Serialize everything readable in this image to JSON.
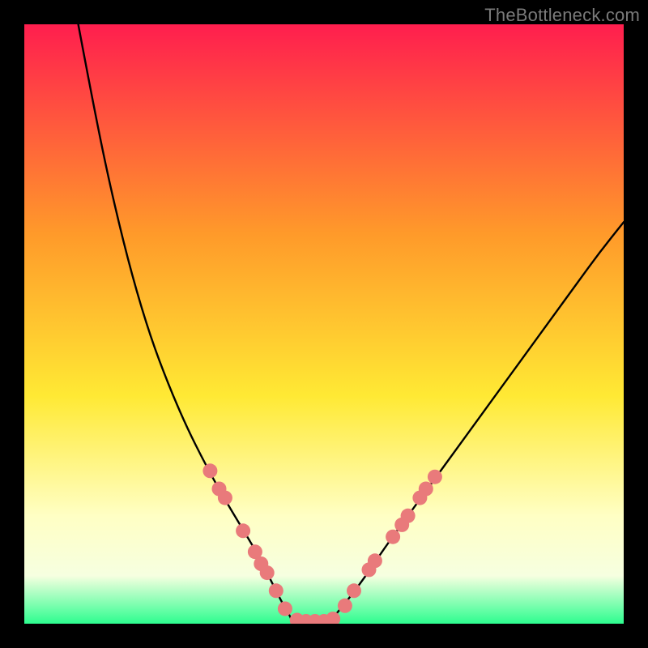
{
  "watermark": "TheBottleneck.com",
  "colors": {
    "bg_black": "#000000",
    "gradient_top": "#ff1e4e",
    "gradient_mid1": "#ff7a2a",
    "gradient_mid2": "#ffe934",
    "gradient_pale": "#ffffc4",
    "gradient_green": "#2dfd8f",
    "curve": "#000000",
    "marker_fill": "#e97a7b",
    "marker_stroke": "#c9494a"
  },
  "chart_data": {
    "type": "line",
    "title": "",
    "xlabel": "",
    "ylabel": "",
    "xlim": [
      0,
      100
    ],
    "ylim": [
      0,
      100
    ],
    "grid": false,
    "legend": false,
    "comment": "Bottleneck-style V curve. x = normalized component balance (0..100), y = bottleneck % (0..100). Minimum (0%) around x≈44..52. Left branch steeper, tops at y=100 near x≈9; right branch shallower, reaches y≈67 at x=100. Markers are the salmon dots along both branches and along the flat bottom.",
    "series": [
      {
        "name": "left_branch",
        "x": [
          9.0,
          12.0,
          15.0,
          18.0,
          21.0,
          24.0,
          27.0,
          30.0,
          33.0,
          36.0,
          39.0,
          41.0,
          43.0,
          44.5
        ],
        "y": [
          100.0,
          84.0,
          70.0,
          58.0,
          48.0,
          40.0,
          33.0,
          27.0,
          21.5,
          16.5,
          11.5,
          7.5,
          3.5,
          1.0
        ]
      },
      {
        "name": "flat_bottom",
        "x": [
          44.5,
          46.0,
          48.0,
          50.0,
          51.5
        ],
        "y": [
          0.5,
          0.3,
          0.3,
          0.3,
          0.5
        ]
      },
      {
        "name": "right_branch",
        "x": [
          51.5,
          54.0,
          57.0,
          60.0,
          64.0,
          68.0,
          72.0,
          76.0,
          80.0,
          84.0,
          88.0,
          92.0,
          96.0,
          100.0
        ],
        "y": [
          1.0,
          4.0,
          8.0,
          12.5,
          18.0,
          23.5,
          29.0,
          34.5,
          40.0,
          45.5,
          51.0,
          56.5,
          62.0,
          67.0
        ]
      }
    ],
    "markers": [
      {
        "x": 31.0,
        "y": 25.5
      },
      {
        "x": 32.5,
        "y": 22.5
      },
      {
        "x": 33.5,
        "y": 21.0
      },
      {
        "x": 36.5,
        "y": 15.5
      },
      {
        "x": 38.5,
        "y": 12.0
      },
      {
        "x": 39.5,
        "y": 10.0
      },
      {
        "x": 40.5,
        "y": 8.5
      },
      {
        "x": 42.0,
        "y": 5.5
      },
      {
        "x": 43.5,
        "y": 2.5
      },
      {
        "x": 45.5,
        "y": 0.6
      },
      {
        "x": 47.0,
        "y": 0.4
      },
      {
        "x": 48.5,
        "y": 0.4
      },
      {
        "x": 50.0,
        "y": 0.4
      },
      {
        "x": 51.5,
        "y": 0.8
      },
      {
        "x": 53.5,
        "y": 3.0
      },
      {
        "x": 55.0,
        "y": 5.5
      },
      {
        "x": 57.5,
        "y": 9.0
      },
      {
        "x": 58.5,
        "y": 10.5
      },
      {
        "x": 61.5,
        "y": 14.5
      },
      {
        "x": 63.0,
        "y": 16.5
      },
      {
        "x": 64.0,
        "y": 18.0
      },
      {
        "x": 66.0,
        "y": 21.0
      },
      {
        "x": 67.0,
        "y": 22.5
      },
      {
        "x": 68.5,
        "y": 24.5
      }
    ]
  }
}
